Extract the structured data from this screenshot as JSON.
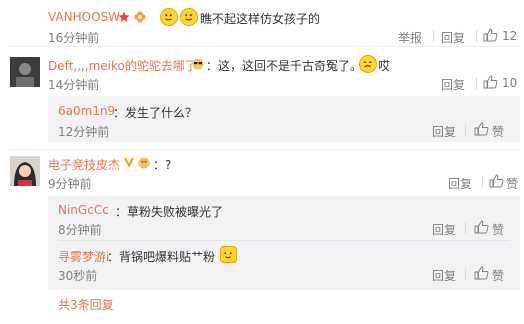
{
  "comments": [
    {
      "username": "VANHOOSW",
      "text": "瞧不起这样仿女孩子的",
      "time": "16分钟前",
      "report": "举报",
      "reply": "回复",
      "likes": "12",
      "colors": {
        "avatar_bg": "#6b6b6b"
      }
    },
    {
      "username": "Deft,,,,meiko的驼驼去哪了",
      "text_a": "：这，这回不是千古奇冤了。",
      "text_b": "哎",
      "time": "14分钟前",
      "reply": "回复",
      "likes": "10",
      "replies": [
        {
          "username": "6a0m1n9",
          "text": "：发生了什么？",
          "time": "12分钟前",
          "reply": "回复",
          "like": "赞"
        }
      ]
    },
    {
      "username": "电子竞技皮杰",
      "text": "：?",
      "time": "9分钟前",
      "reply": "回复",
      "like": "赞",
      "replies": [
        {
          "username": "NinGcCc",
          "text": "：草粉失败被曝光了",
          "time": "8分钟前",
          "reply": "回复",
          "like": "赞"
        },
        {
          "username": "寻雾梦游i",
          "text": "：背锅吧爆料贴艹粉",
          "time": "30秒前",
          "reply": "回复",
          "like": "赞"
        }
      ]
    }
  ],
  "more_replies": "共3条回复",
  "colors": {
    "username": "#eb7350",
    "muted": "#808080",
    "subbox": "#f2f2f5"
  }
}
